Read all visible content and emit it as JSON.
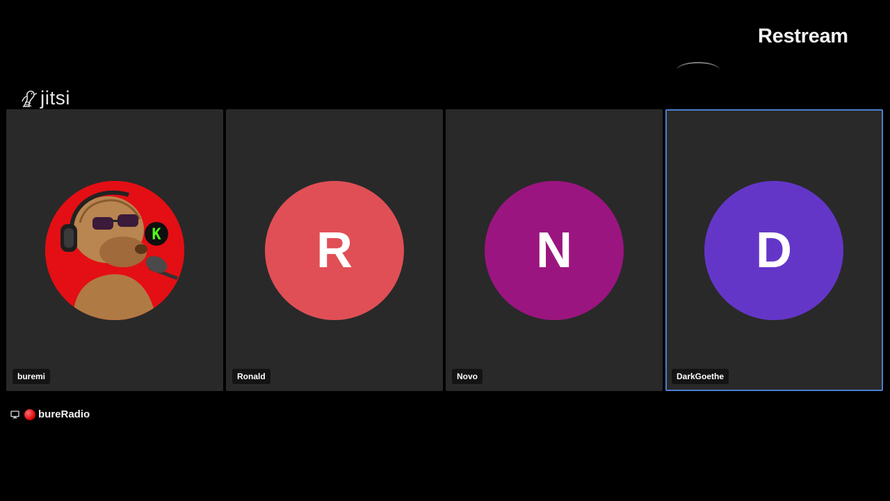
{
  "branding": {
    "restream_label": "Restream",
    "jitsi_label": "jitsi"
  },
  "participants": [
    {
      "name": "buremi",
      "avatar_type": "image",
      "avatar_description_icon": "alf-headphones-avatar",
      "active": false
    },
    {
      "name": "Ronald",
      "initial": "R",
      "avatar_color": "#e04f56",
      "active": false
    },
    {
      "name": "Novo",
      "initial": "N",
      "avatar_color": "#9b1580",
      "active": false
    },
    {
      "name": "DarkGoethe",
      "initial": "D",
      "avatar_color": "#6436c8",
      "active": true
    }
  ],
  "stream": {
    "label": "bureRadio",
    "icon": "monitor-icon",
    "live_indicator_color": "#e01010"
  },
  "colors": {
    "background": "#000000",
    "tile_background": "#292929",
    "active_border": "#4c7ecf"
  }
}
